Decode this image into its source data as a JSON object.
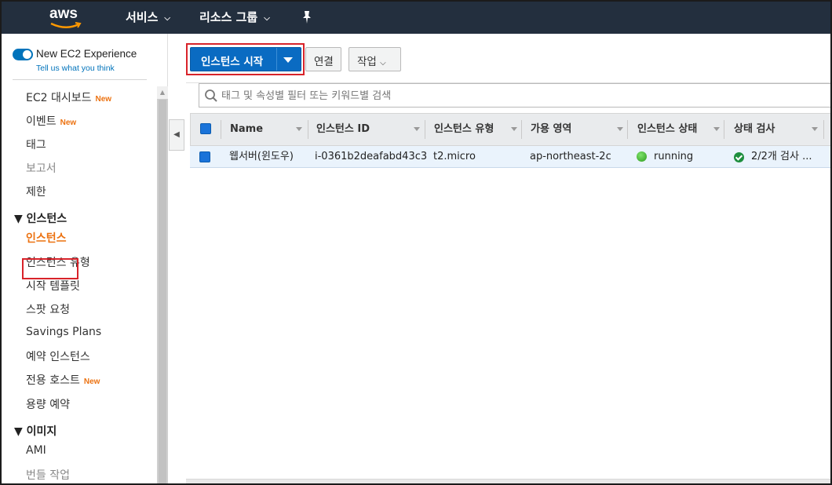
{
  "topnav": {
    "logo": "aws",
    "services_label": "서비스",
    "resource_groups_label": "리소스 그룹",
    "pin_icon": "pin-icon"
  },
  "sidebar": {
    "toggle_label": "New EC2 Experience",
    "toggle_link": "Tell us what you think",
    "toggle_on": true,
    "items": [
      {
        "label": "EC2 대시보드",
        "badge": "New"
      },
      {
        "label": "이벤트",
        "badge": "New"
      },
      {
        "label": "태그"
      },
      {
        "label": "보고서"
      },
      {
        "label": "제한"
      }
    ],
    "section_instances": "▼ 인스턴스",
    "instances_items": [
      {
        "label": "인스턴스"
      },
      {
        "label": "인스턴스 유형"
      },
      {
        "label": "시작 템플릿"
      },
      {
        "label": "스팟 요청"
      },
      {
        "label": "Savings Plans"
      },
      {
        "label": "예약 인스턴스"
      },
      {
        "label": "전용 호스트",
        "badge": "New"
      },
      {
        "label": "용량 예약"
      }
    ],
    "section_images": "▼ 이미지",
    "images_items": [
      {
        "label": "AMI"
      },
      {
        "label": "번들 작업"
      }
    ]
  },
  "toolbar": {
    "launch_label": "인스턴스 시작",
    "connect_label": "연결",
    "actions_label": "작업"
  },
  "search": {
    "placeholder": "태그 및 속성별 필터 또는 키워드별 검색"
  },
  "table": {
    "columns": [
      "Name",
      "인스턴스 ID",
      "인스턴스 유형",
      "가용 영역",
      "인스턴스 상태",
      "상태 검사"
    ],
    "rows": [
      {
        "name": "웹서버(윈도우)",
        "instance_id": "i-0361b2deafabd43c3",
        "instance_type": "t2.micro",
        "availability_zone": "ap-northeast-2c",
        "state": "running",
        "status_check": "2/2개 검사 ..."
      }
    ]
  },
  "colors": {
    "nav_bg": "#232f3e",
    "primary": "#0a6bc2",
    "new_badge": "#ec7211",
    "highlight_outline": "#d8232a",
    "running": "#2e9b1e"
  }
}
